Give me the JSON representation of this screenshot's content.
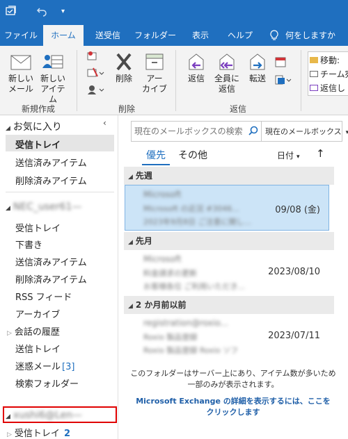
{
  "ribbon_tabs": {
    "file": "ファイル",
    "home": "ホーム",
    "send_receive": "送受信",
    "folder": "フォルダー",
    "view": "表示",
    "help": "ヘルプ",
    "tell_me": "何をしますか"
  },
  "ribbon": {
    "new_mail_l1": "新しい",
    "new_mail_l2": "メール",
    "new_items_l1": "新しい",
    "new_items_l2": "アイテム",
    "group_new": "新規作成",
    "delete": "削除",
    "archive_l1": "アー",
    "archive_l2": "カイブ",
    "group_delete": "削除",
    "reply": "返信",
    "reply_all_l1": "全員に",
    "reply_all_l2": "返信",
    "forward": "転送",
    "group_reply": "返信",
    "move": "移動:",
    "team_email": "チーム宛",
    "reply_delete": "返信し"
  },
  "folders": {
    "favorites_header": "お気に入り",
    "fav_inbox": "受信トレイ",
    "fav_sent": "送信済みアイテム",
    "fav_deleted": "削除済みアイテム",
    "account1": "NEC_user61—",
    "inbox": "受信トレイ",
    "drafts": "下書き",
    "sent": "送信済みアイテム",
    "deleted": "削除済みアイテム",
    "rss": "RSS フィード",
    "archive": "アーカイブ",
    "conversation_history": "会話の履歴",
    "outbox": "送信トレイ",
    "junk": "迷惑メール",
    "junk_count": "[3]",
    "search_folders": "検索フォルダー",
    "account2": "xushi6@Len—",
    "inbox2": "受信トレイ",
    "inbox2_count": "2"
  },
  "message_list": {
    "search_placeholder": "現在のメールボックスの検索",
    "scope": "現在のメールボックス",
    "tab_focused": "優先",
    "tab_other": "その他",
    "sort_label": "日付",
    "sort_arrow": "↑",
    "groups": [
      {
        "header": "先週",
        "mails": [
          {
            "from": "Microsoft",
            "subject": "Microsoft の近況 #3046...",
            "preview": "2023年9月8日 ご注意に関し...",
            "date": "09/08 (金)"
          }
        ]
      },
      {
        "header": "先月",
        "mails": [
          {
            "from": "Microsoft",
            "subject": "料金請求の更新",
            "preview": "お客様各位 ご利用いただき...",
            "date": "2023/08/10"
          }
        ]
      },
      {
        "header": "2 か月前以前",
        "mails": [
          {
            "from": "registration@roxio...",
            "subject": "Roxio 製品登録",
            "preview": "Roxio 製品登録 Roxio ソフ",
            "date": "2023/07/11"
          }
        ]
      }
    ],
    "server_note_l1": "このフォルダーはサーバー上にあり、アイテム数が多いため",
    "server_note_l2": "一部のみが表示されます。",
    "exchange_link_l1": "Microsoft Exchange の詳細を表示するには、ここを",
    "exchange_link_l2": "クリックします"
  },
  "colors": {
    "accent": "#1f6fbf",
    "selection": "#cce4f7",
    "highlight_box": "#e00000"
  }
}
